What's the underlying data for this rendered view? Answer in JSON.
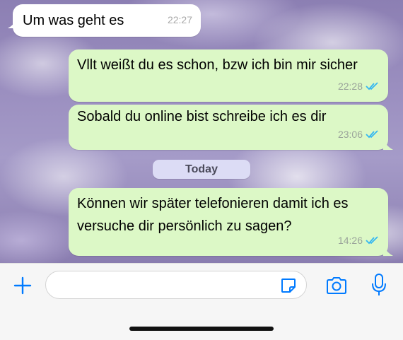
{
  "messages": [
    {
      "direction": "incoming",
      "text": "Um was geht es",
      "time": "22:27"
    },
    {
      "direction": "outgoing",
      "text": "Vllt weißt du es schon, bzw ich bin mir sicher",
      "time": "22:28",
      "status": "read"
    },
    {
      "direction": "outgoing",
      "text": "Sobald du online bist schreibe ich es dir",
      "time": "23:06",
      "status": "read"
    },
    {
      "direction": "outgoing",
      "text": "Können wir später telefonieren damit ich es versuche dir persönlich zu sagen?",
      "time": "14:26",
      "status": "read"
    }
  ],
  "date_separator": "Today",
  "input_bar": {
    "placeholder": "",
    "icons": [
      "plus-icon",
      "sticker-icon",
      "camera-icon",
      "microphone-icon"
    ]
  },
  "colors": {
    "accent": "#007aff",
    "outgoing_bubble": "#dcf8c6",
    "incoming_bubble": "#ffffff",
    "read_ticks": "#34b7f1"
  }
}
